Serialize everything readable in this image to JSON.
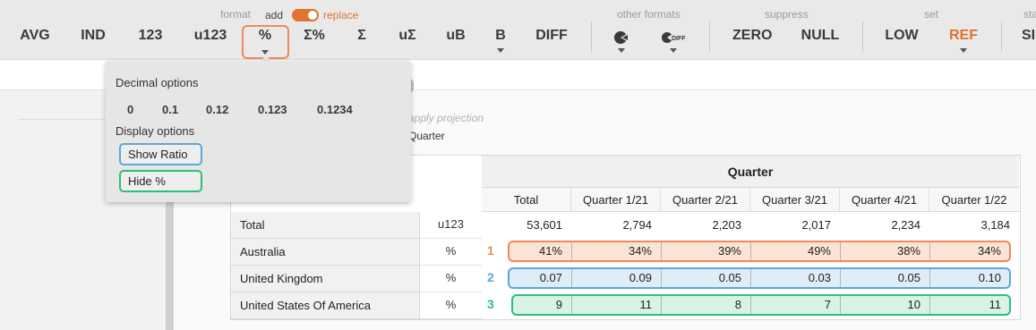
{
  "toolbar": {
    "group_labels": {
      "format": "format",
      "other_formats": "other formats",
      "suppress": "suppress",
      "set": "set",
      "stats_partial": "sta"
    },
    "mode_toggle": {
      "add_label": "add",
      "replace_label": "replace",
      "state": "replace"
    },
    "buttons": {
      "avg": "AVG",
      "ind": "IND",
      "n123": "123",
      "u123": "u123",
      "pct": "%",
      "sum_pct": "Σ%",
      "sum": "Σ",
      "u_sum": "uΣ",
      "ub": "uB",
      "b": "B",
      "diff": "DIFF",
      "zero": "ZERO",
      "null": "NULL",
      "low": "LOW",
      "ref": "REF",
      "si": "SI"
    },
    "icon_names": [
      "pie-sig-icon",
      "pie-diff-icon"
    ],
    "icon_text": {
      "diff_mini": "DIFF"
    },
    "accent_color": "#e0732f"
  },
  "popup": {
    "decimal_title": "Decimal options",
    "decimal_options": [
      "0",
      "0.1",
      "0.12",
      "0.123",
      "0.1234"
    ],
    "display_title": "Display options",
    "show_ratio": "Show Ratio",
    "hide_pct": "Hide %"
  },
  "background": {
    "faded_hint": "apply projection",
    "faded_column": "Quarter"
  },
  "table": {
    "group_header": "Quarter",
    "columns": [
      "Total",
      "Quarter 1/21",
      "Quarter 2/21",
      "Quarter 3/21",
      "Quarter 4/21",
      "Quarter 1/22"
    ],
    "rows": [
      {
        "label": "Total",
        "format": "u123",
        "values": [
          "53,601",
          "2,794",
          "2,203",
          "2,017",
          "2,234",
          "3,184"
        ],
        "marker": ""
      },
      {
        "label": "Australia",
        "format": "%",
        "values": [
          "41%",
          "34%",
          "39%",
          "49%",
          "38%",
          "34%"
        ],
        "marker": "1"
      },
      {
        "label": "United Kingdom",
        "format": "%",
        "values": [
          "0.07",
          "0.09",
          "0.05",
          "0.03",
          "0.05",
          "0.10"
        ],
        "marker": "2"
      },
      {
        "label": "United States Of America",
        "format": "%",
        "values": [
          "9",
          "11",
          "8",
          "7",
          "10",
          "11"
        ],
        "marker": "3"
      }
    ],
    "highlight_colors": {
      "orange": "#ef8a5c",
      "blue": "#5ba8d8",
      "green": "#2fbe7a"
    }
  }
}
